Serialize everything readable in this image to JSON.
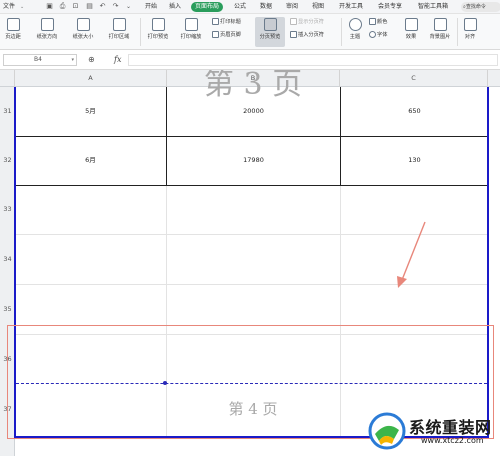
{
  "menubar": {
    "file_menu": "文件",
    "quick_access": [
      "save-icon",
      "print-icon",
      "print-preview-icon",
      "undo-icon",
      "redo-icon"
    ],
    "tabs": [
      "开始",
      "插入",
      "页面布局",
      "公式",
      "数据",
      "审阅",
      "视图",
      "开发工具",
      "会员专享",
      "智能工具箱"
    ],
    "active_tab": "页面布局",
    "search_label": "查找命令"
  },
  "ribbon": {
    "margin": "页边距",
    "orientation": "纸张方向",
    "size": "纸张大小",
    "print_area": "打印区域",
    "print_preview": "打印预览",
    "print_scale": "打印缩放",
    "print_titles": "打印标题",
    "header_footer": "页眉页脚",
    "page_break_preview": "分页预览",
    "show_page_break": "显示分页符",
    "insert_page_break": "插入分页符",
    "theme": "主题",
    "colors": "颜色",
    "font": "字体",
    "effects": "效果",
    "background": "背景图片",
    "align": "对齐"
  },
  "formula_bar": {
    "cell_ref": "B4",
    "fx_label": "fx",
    "value": ""
  },
  "sheet": {
    "columns": [
      "A",
      "B",
      "C"
    ],
    "rows": [
      {
        "num": "31",
        "a": "5月",
        "b": "20000",
        "c": "650"
      },
      {
        "num": "32",
        "a": "6月",
        "b": "17980",
        "c": "130"
      },
      {
        "num": "33",
        "a": "",
        "b": "",
        "c": ""
      },
      {
        "num": "34",
        "a": "",
        "b": "",
        "c": ""
      },
      {
        "num": "35",
        "a": "",
        "b": "",
        "c": ""
      },
      {
        "num": "36",
        "a": "",
        "b": "",
        "c": ""
      },
      {
        "num": "37",
        "a": "",
        "b": "",
        "c": ""
      }
    ],
    "page3_label": "第 3 页",
    "page4_label": "第 4 页"
  },
  "colors": {
    "active_tab": "#2a9d5c",
    "print_border": "#1a1ac8",
    "annotation": "#e8877b"
  },
  "watermark": {
    "title": "系统重装网",
    "url": "www.xtcz2.com"
  }
}
